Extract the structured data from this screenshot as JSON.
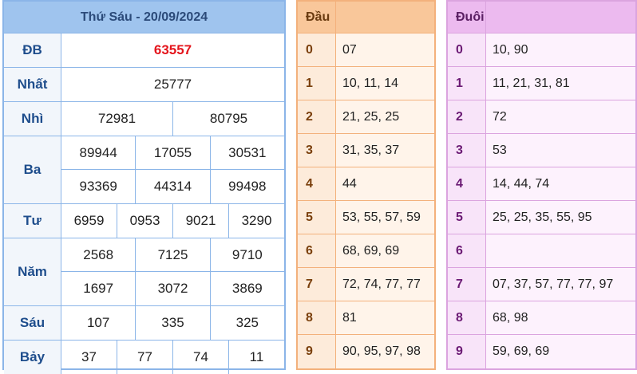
{
  "result": {
    "title": "Thứ Sáu - 20/09/2024",
    "prizes": [
      {
        "name": "ĐB",
        "rows": [
          [
            "63557"
          ]
        ]
      },
      {
        "name": "Nhất",
        "rows": [
          [
            "25777"
          ]
        ]
      },
      {
        "name": "Nhì",
        "rows": [
          [
            "72981",
            "80795"
          ]
        ]
      },
      {
        "name": "Ba",
        "rows": [
          [
            "89944",
            "17055",
            "30531"
          ],
          [
            "93369",
            "44314",
            "99498"
          ]
        ]
      },
      {
        "name": "Tư",
        "rows": [
          [
            "6959",
            "0953",
            "9021",
            "3290"
          ]
        ]
      },
      {
        "name": "Năm",
        "rows": [
          [
            "2568",
            "7125",
            "9710"
          ],
          [
            "1697",
            "3072",
            "3869"
          ]
        ]
      },
      {
        "name": "Sáu",
        "rows": [
          [
            "107",
            "335",
            "325"
          ]
        ]
      },
      {
        "name": "Bảy",
        "rows": [
          [
            "37",
            "77",
            "74",
            "11"
          ]
        ]
      }
    ]
  },
  "dau": {
    "header": "Đầu",
    "rows": [
      {
        "digit": "0",
        "values": "07"
      },
      {
        "digit": "1",
        "values": "10, 11, 14"
      },
      {
        "digit": "2",
        "values": "21, 25, 25"
      },
      {
        "digit": "3",
        "values": "31, 35, 37"
      },
      {
        "digit": "4",
        "values": "44"
      },
      {
        "digit": "5",
        "values": "53, 55, 57, 59"
      },
      {
        "digit": "6",
        "values": "68, 69, 69"
      },
      {
        "digit": "7",
        "values": "72, 74, 77, 77"
      },
      {
        "digit": "8",
        "values": "81"
      },
      {
        "digit": "9",
        "values": "90, 95, 97, 98"
      }
    ]
  },
  "duoi": {
    "header": "Đuôi",
    "rows": [
      {
        "digit": "0",
        "values": "10, 90"
      },
      {
        "digit": "1",
        "values": "11, 21, 31, 81"
      },
      {
        "digit": "2",
        "values": "72"
      },
      {
        "digit": "3",
        "values": "53"
      },
      {
        "digit": "4",
        "values": "14, 44, 74"
      },
      {
        "digit": "5",
        "values": "25, 25, 35, 55, 95"
      },
      {
        "digit": "6",
        "values": ""
      },
      {
        "digit": "7",
        "values": "07, 37, 57, 77, 77, 97"
      },
      {
        "digit": "8",
        "values": "68, 98"
      },
      {
        "digit": "9",
        "values": "59, 69, 69"
      }
    ]
  },
  "colors": {
    "special_prize": "#e4151c",
    "result_border": "#8bb5e8",
    "result_header": "#9fc4ee",
    "dau_header": "#f9c79a",
    "duoi_header": "#ecbaef"
  }
}
